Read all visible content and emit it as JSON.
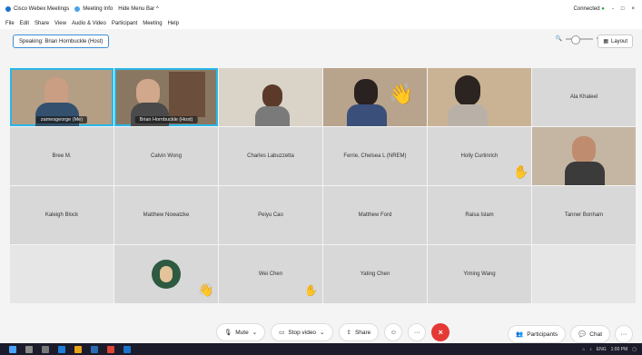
{
  "titlebar": {
    "app_title": "Cisco Webex Meetings",
    "meeting_info": "Meeting Info",
    "hide_menu": "Hide Menu Bar ^",
    "status": "Connected",
    "window_controls": [
      "-",
      "□",
      "×"
    ]
  },
  "menubar": [
    "File",
    "Edit",
    "Share",
    "View",
    "Audio & Video",
    "Participant",
    "Meeting",
    "Help"
  ],
  "speaking": "Speaking: Brian Hornbuckle (Host)",
  "layout_label": "Layout",
  "tiles": [
    {
      "name": "zamesgeorge (Me)",
      "video": true
    },
    {
      "name": "Brian Hornbuckle (Host)",
      "video": true
    },
    {
      "name": "",
      "video": true
    },
    {
      "name": "",
      "video": true
    },
    {
      "name": "",
      "video": true
    },
    {
      "name": "Ala Khaleel"
    },
    {
      "name": "Bree M."
    },
    {
      "name": "Calvin Wong"
    },
    {
      "name": "Charles Labuzzetta"
    },
    {
      "name": "Ferrie, Chelsea L (NREM)"
    },
    {
      "name": "Holly Curtinrich"
    },
    {
      "name": "",
      "video": true
    },
    {
      "name": "Kaleigh Block"
    },
    {
      "name": "Matthew Nowatzke"
    },
    {
      "name": "Peiyu Cao"
    },
    {
      "name": "Matthew Ford"
    },
    {
      "name": "Raisa Islam"
    },
    {
      "name": "Tanner Bonham"
    },
    {
      "name": ""
    },
    {
      "name": ""
    },
    {
      "name": "Wei Chen"
    },
    {
      "name": "Yating Chen"
    },
    {
      "name": "Yiming Wang"
    }
  ],
  "controls": {
    "mute": "Mute",
    "stop_video": "Stop video",
    "share": "Share",
    "participants": "Participants",
    "chat": "Chat"
  },
  "taskbar": {
    "time": "1:00 PM",
    "lang": "ENG"
  }
}
